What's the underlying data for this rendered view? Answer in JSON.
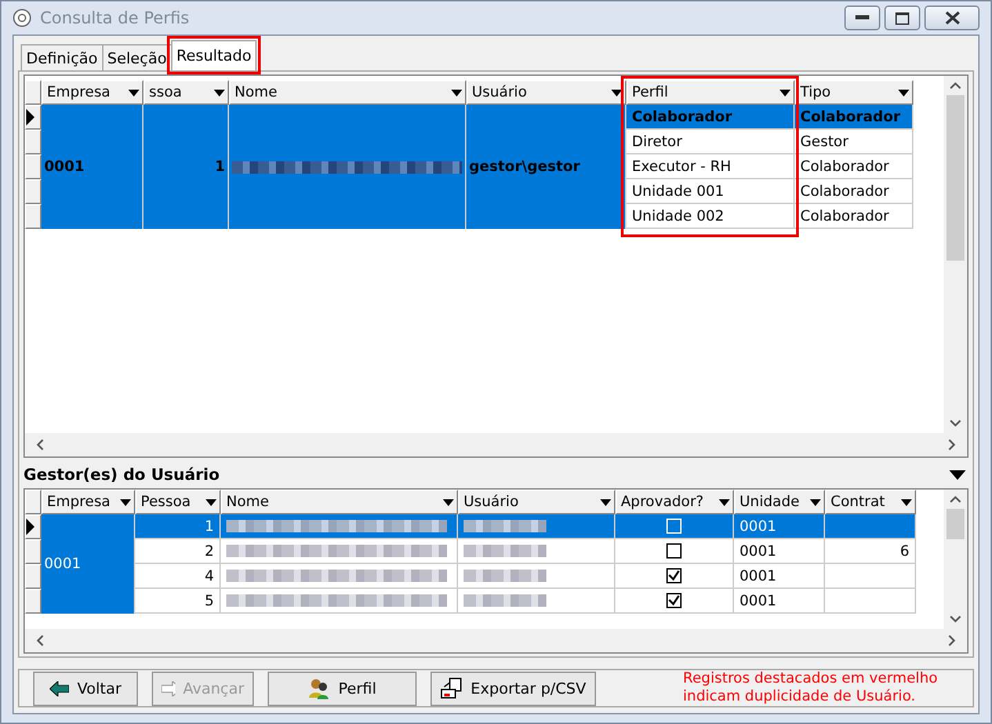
{
  "window": {
    "title": "Consulta de Perfis"
  },
  "tabs": [
    {
      "label": "Definição",
      "selected": false
    },
    {
      "label": "Seleção",
      "selected": false
    },
    {
      "label": "Resultado",
      "selected": true
    }
  ],
  "profiles_grid": {
    "columns": [
      "Empresa",
      "ssoa",
      "Nome",
      "Usuário",
      "Perfil",
      "Tipo"
    ],
    "group": {
      "empresa": "0001",
      "pessoa": "1",
      "usuario": "gestor\\gestor",
      "selected": true
    },
    "rows": [
      {
        "perfil": "Colaborador",
        "tipo": "Colaborador",
        "selected": true
      },
      {
        "perfil": "Diretor",
        "tipo": "Gestor",
        "selected": false
      },
      {
        "perfil": "Executor - RH",
        "tipo": "Colaborador",
        "selected": false
      },
      {
        "perfil": "Unidade 001",
        "tipo": "Colaborador",
        "selected": false
      },
      {
        "perfil": "Unidade 002",
        "tipo": "Colaborador",
        "selected": false
      }
    ]
  },
  "managers_section": {
    "title": "Gestor(es) do Usuário"
  },
  "managers_grid": {
    "columns": [
      "Empresa",
      "Pessoa",
      "Nome",
      "Usuário",
      "Aprovador?",
      "Unidade",
      "Contrat"
    ],
    "empresa": "0001",
    "rows": [
      {
        "pessoa": "1",
        "aprovador": false,
        "unidade": "0001",
        "contrat": "",
        "selected": true
      },
      {
        "pessoa": "2",
        "aprovador": false,
        "unidade": "0001",
        "contrat": "6",
        "selected": false
      },
      {
        "pessoa": "4",
        "aprovador": true,
        "unidade": "0001",
        "contrat": "",
        "selected": false
      },
      {
        "pessoa": "5",
        "aprovador": true,
        "unidade": "0001",
        "contrat": "",
        "selected": false
      }
    ]
  },
  "buttons": [
    {
      "label": "Voltar",
      "kind": "back",
      "disabled": false
    },
    {
      "label": "Avançar",
      "kind": "forward",
      "disabled": true
    },
    {
      "label": "Perfil",
      "kind": "profile",
      "disabled": false
    },
    {
      "label": "Exportar p/CSV",
      "kind": "export",
      "disabled": false
    }
  ],
  "note": "Registros destacados em vermelho indicam duplicidade de Usuário."
}
